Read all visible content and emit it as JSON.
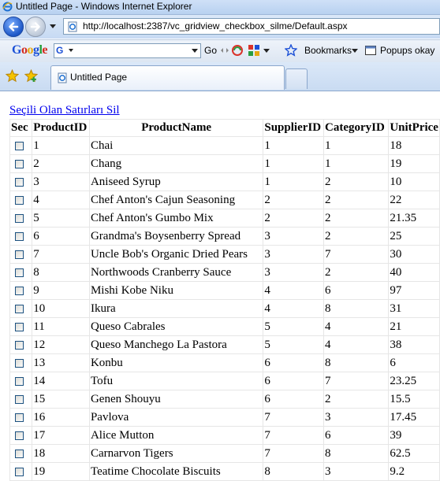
{
  "window": {
    "title": "Untitled Page - Windows Internet Explorer"
  },
  "address_bar": {
    "url": "http://localhost:2387/vc_gridview_checkbox_silme/Default.aspx"
  },
  "google_toolbar": {
    "logo": "Google",
    "search_badge": "G",
    "go_label": "Go",
    "bookmarks_label": "Bookmarks",
    "popups_label": "Popups okay"
  },
  "tabs": [
    {
      "label": "Untitled Page"
    }
  ],
  "page": {
    "delete_link": "Seçili Olan Satırları Sil",
    "columns": [
      "Sec",
      "ProductID",
      "ProductName",
      "SupplierID",
      "CategoryID",
      "UnitPrice"
    ],
    "rows": [
      {
        "id": "1",
        "name": "Chai",
        "supplier": "1",
        "category": "1",
        "price": "18"
      },
      {
        "id": "2",
        "name": "Chang",
        "supplier": "1",
        "category": "1",
        "price": "19"
      },
      {
        "id": "3",
        "name": "Aniseed Syrup",
        "supplier": "1",
        "category": "2",
        "price": "10"
      },
      {
        "id": "4",
        "name": "Chef Anton's Cajun Seasoning",
        "supplier": "2",
        "category": "2",
        "price": "22"
      },
      {
        "id": "5",
        "name": "Chef Anton's Gumbo Mix",
        "supplier": "2",
        "category": "2",
        "price": "21.35"
      },
      {
        "id": "6",
        "name": "Grandma's Boysenberry Spread",
        "supplier": "3",
        "category": "2",
        "price": "25"
      },
      {
        "id": "7",
        "name": "Uncle Bob's Organic Dried Pears",
        "supplier": "3",
        "category": "7",
        "price": "30"
      },
      {
        "id": "8",
        "name": "Northwoods Cranberry Sauce",
        "supplier": "3",
        "category": "2",
        "price": "40"
      },
      {
        "id": "9",
        "name": "Mishi Kobe Niku",
        "supplier": "4",
        "category": "6",
        "price": "97"
      },
      {
        "id": "10",
        "name": "Ikura",
        "supplier": "4",
        "category": "8",
        "price": "31"
      },
      {
        "id": "11",
        "name": "Queso Cabrales",
        "supplier": "5",
        "category": "4",
        "price": "21"
      },
      {
        "id": "12",
        "name": "Queso Manchego La Pastora",
        "supplier": "5",
        "category": "4",
        "price": "38"
      },
      {
        "id": "13",
        "name": "Konbu",
        "supplier": "6",
        "category": "8",
        "price": "6"
      },
      {
        "id": "14",
        "name": "Tofu",
        "supplier": "6",
        "category": "7",
        "price": "23.25"
      },
      {
        "id": "15",
        "name": "Genen Shouyu",
        "supplier": "6",
        "category": "2",
        "price": "15.5"
      },
      {
        "id": "16",
        "name": "Pavlova",
        "supplier": "7",
        "category": "3",
        "price": "17.45"
      },
      {
        "id": "17",
        "name": "Alice Mutton",
        "supplier": "7",
        "category": "6",
        "price": "39"
      },
      {
        "id": "18",
        "name": "Carnarvon Tigers",
        "supplier": "7",
        "category": "8",
        "price": "62.5"
      },
      {
        "id": "19",
        "name": "Teatime Chocolate Biscuits",
        "supplier": "8",
        "category": "3",
        "price": "9.2"
      }
    ]
  },
  "colors": {
    "link": "#0000ee",
    "chrome_blue": "#c7daf3"
  }
}
